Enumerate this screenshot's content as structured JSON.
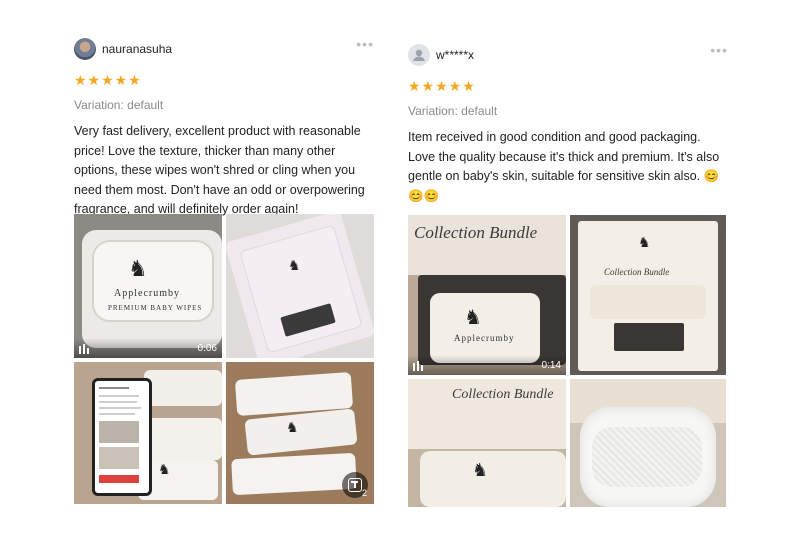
{
  "reviews": [
    {
      "username": "nauranasuha",
      "rating": 5,
      "stars": "★★★★★",
      "more_icon": "•••",
      "variation": "Variation: default",
      "text": "Very fast delivery, excellent product with reasonable price! Love the texture, thicker than many other options, these wipes won't shred or cling when you need them most. Don't have an odd or overpowering fragrance, and will definitely order again!",
      "media": {
        "video_duration": "0:06",
        "extra_count": "2",
        "package_brand": "Applecrumby",
        "package_sub": "PREMIUM BABY WIPES"
      }
    },
    {
      "username": "w*****x",
      "rating": 5,
      "stars": "★★★★★",
      "more_icon": "•••",
      "variation": "Variation: default",
      "text": "Item received in good condition and good packaging. Love the quality because it's thick and premium. It's also gentle on baby's skin, suitable for sensitive skin also. 😊😊😊",
      "media": {
        "video_duration": "0:14",
        "package_title": "Collection Bundle",
        "package_brand": "Applecrumby"
      }
    }
  ],
  "colors": {
    "star": "#f5a623",
    "muted": "#8a8a8a",
    "text": "#222222"
  }
}
